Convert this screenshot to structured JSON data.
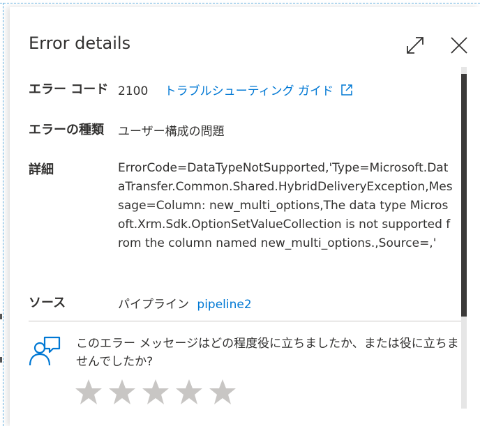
{
  "panel": {
    "title": "Error details",
    "expand_icon": "expand-icon",
    "close_icon": "close-icon"
  },
  "error_code": {
    "label": "エラー コード",
    "value": "2100",
    "link_text": "トラブルシューティング ガイド",
    "link_icon": "external-link-icon"
  },
  "error_type": {
    "label": "エラーの種類",
    "value": "ユーザー構成の問題"
  },
  "details": {
    "label": "詳細",
    "value": "ErrorCode=DataTypeNotSupported,'Type=Microsoft.DataTransfer.Common.Shared.HybridDeliveryException,Message=Column: new_multi_options,The data type Microsoft.Xrm.Sdk.OptionSetValueCollection is not supported from the column named new_multi_options.,Source=,'"
  },
  "source": {
    "label": "ソース",
    "prefix": "パイプライン",
    "link_text": "pipeline2"
  },
  "feedback": {
    "icon": "feedback-person-icon",
    "question": "このエラー メッセージはどの程度役に立ちましたか、または役に立ちませんでしたか?",
    "rating": 0,
    "max_rating": 5
  },
  "colors": {
    "link": "#0078d4",
    "text": "#323130",
    "star_empty": "#c8c6c4",
    "scroll_thumb": "#3b3a39"
  }
}
